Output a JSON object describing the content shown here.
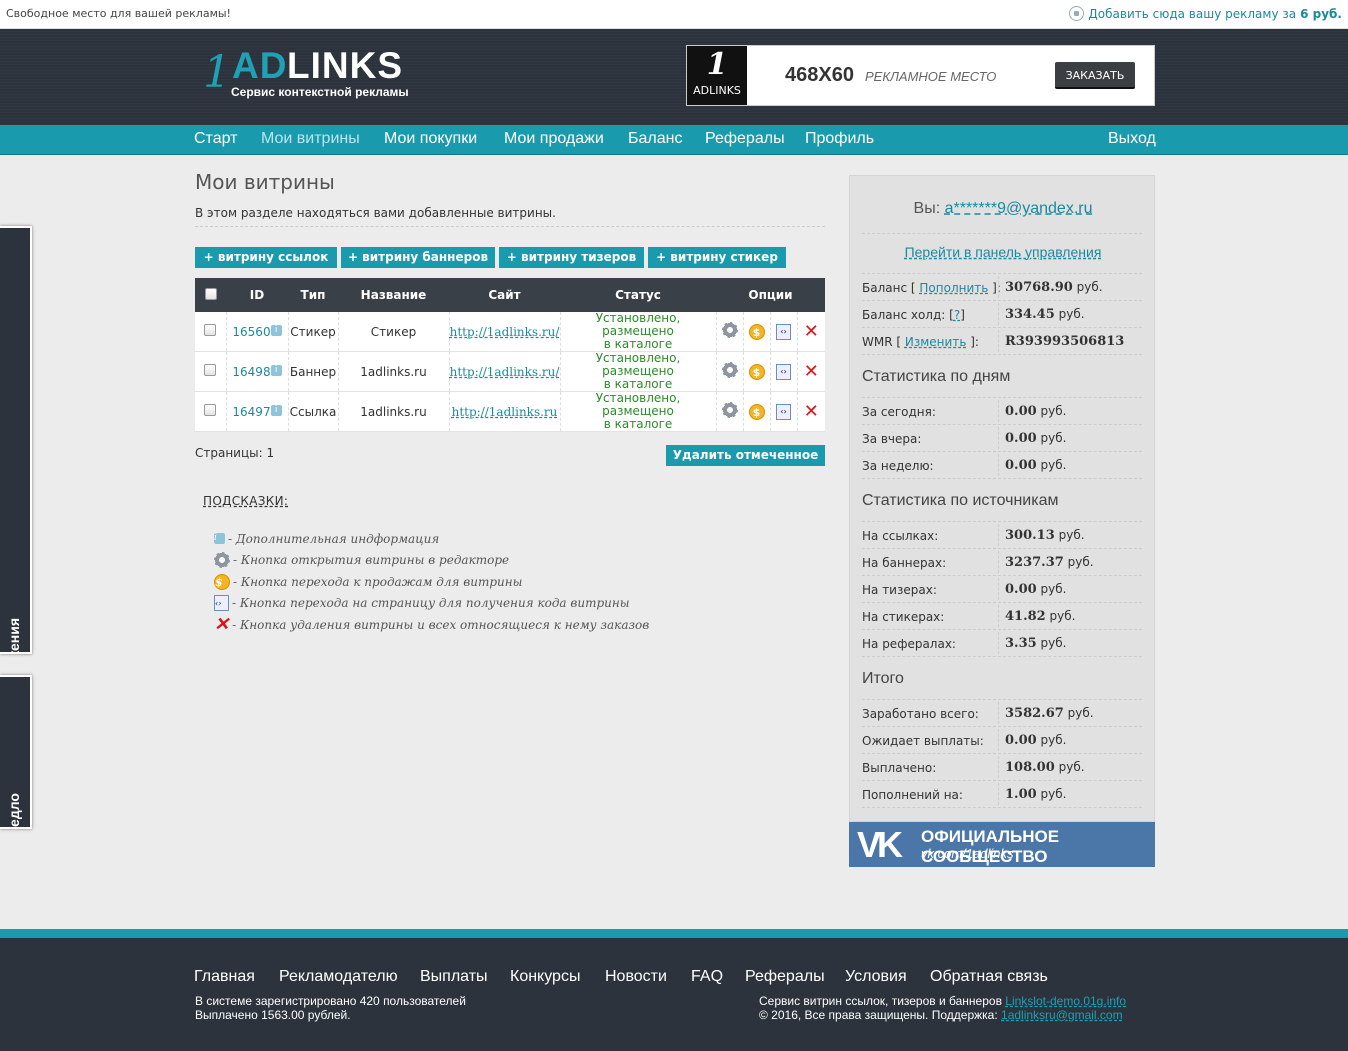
{
  "topbar": {
    "left_text": "Свободное место для вашей рекламы!",
    "right_text": "Добавить сюда вашу рекламу за",
    "right_price": "6 руб."
  },
  "header": {
    "logo_one": "1",
    "logo_ad": "AD",
    "logo_links": "LINKS",
    "logo_sub": "Сервис контекстной рекламы",
    "banner": {
      "mini_num": "1",
      "mini_text": "ADLINKS",
      "size": "468X60",
      "place": "РЕКЛАМНОЕ МЕСТО",
      "order": "ЗАКАЗАТЬ"
    }
  },
  "nav": {
    "items": [
      "Старт",
      "Мои витрины",
      "Мои покупки",
      "Мои продажи",
      "Баланс",
      "Рефералы",
      "Профиль"
    ],
    "logout": "Выход"
  },
  "sidetabs": {
    "tab1": "Отзывы и предлавы и предложения",
    "tab2": "Отзывы и предло"
  },
  "main": {
    "title": "Мои витрины",
    "description": "В этом разделе находяться вами добавленные витрины.",
    "add_buttons": [
      "+ витрину ссылок",
      "+ витрину баннеров",
      "+ витрину тизеров",
      "+ витрину стикер"
    ],
    "table": {
      "headers": [
        "ID",
        "Тип",
        "Название",
        "Сайт",
        "Статус",
        "Опции"
      ],
      "rows": [
        {
          "id": "16560",
          "type": "Стикер",
          "name": "Стикер",
          "site": "http://1adlinks.ru/",
          "status_1": "Установлено, размещено",
          "status_2": "в каталоге"
        },
        {
          "id": "16498",
          "type": "Баннер",
          "name": "1adlinks.ru",
          "site": "http://1adlinks.ru/",
          "status_1": "Установлено, размещено",
          "status_2": "в каталоге"
        },
        {
          "id": "16497",
          "type": "Ссылка",
          "name": "1adlinks.ru",
          "site": "http://1adlinks.ru",
          "status_1": "Установлено, размещено",
          "status_2": "в каталоге"
        }
      ]
    },
    "pages": "Страницы: 1",
    "delete_button": "Удалить отмеченное",
    "hints_title": "ПОДСКАЗКИ:",
    "hints": [
      {
        "icon": "info-icon",
        "text": "- Дополнительная индформация"
      },
      {
        "icon": "gear-icon",
        "text": "- Кнопка открытия витрины в редакторе"
      },
      {
        "icon": "coin-icon",
        "text": "- Кнопка перехода к продажам для витрины"
      },
      {
        "icon": "code-icon",
        "text": "- Кнопка перехода на страницу для получения кода витрины"
      },
      {
        "icon": "delete-icon",
        "text": "- Кнопка удаления витрины и всех относящиеся к нему заказов"
      }
    ]
  },
  "panel": {
    "you_label": "Вы:",
    "email": "a*******9@yandex.ru",
    "control_panel_link": "Перейти в панель управления",
    "balance": [
      {
        "key_pre": "Баланс [",
        "key_link": "Пополнить",
        "key_post": "]:",
        "value": "30768.90",
        "unit": "руб."
      },
      {
        "key_pre": "Баланс холд: [",
        "key_link": "?",
        "key_post": "]",
        "value": "334.45",
        "unit": "руб."
      },
      {
        "key_pre": "WMR [",
        "key_link": "Изменить",
        "key_post": "]:",
        "value": "R393993506813",
        "unit": ""
      }
    ],
    "by_days_title": "Статистика по дням",
    "by_days": [
      {
        "key": "За сегодня:",
        "value": "0.00",
        "unit": "руб."
      },
      {
        "key": "За вчера:",
        "value": "0.00",
        "unit": "руб."
      },
      {
        "key": "За неделю:",
        "value": "0.00",
        "unit": "руб."
      }
    ],
    "by_sources_title": "Статистика по источникам",
    "by_sources": [
      {
        "key": "На ссылках:",
        "value": "300.13",
        "unit": "руб."
      },
      {
        "key": "На баннерах:",
        "value": "3237.37",
        "unit": "руб."
      },
      {
        "key": "На тизерах:",
        "value": "0.00",
        "unit": "руб."
      },
      {
        "key": "На стикерах:",
        "value": "41.82",
        "unit": "руб."
      },
      {
        "key": "На рефералах:",
        "value": "3.35",
        "unit": "руб."
      }
    ],
    "total_title": "Итого",
    "total": [
      {
        "key": "Заработано всего:",
        "value": "3582.67",
        "unit": "руб."
      },
      {
        "key": "Ожидает выплаты:",
        "value": "0.00",
        "unit": "руб."
      },
      {
        "key": "Выплачено:",
        "value": "108.00",
        "unit": "руб."
      },
      {
        "key": "Пополнений на:",
        "value": "1.00",
        "unit": "руб."
      }
    ]
  },
  "vk": {
    "logo": "VK",
    "title": "ОФИЦИАЛЬНОЕ СООБЩЕСТВО",
    "url": "vk.com/1adlinks"
  },
  "footer": {
    "nav": [
      "Главная",
      "Рекламодателю",
      "Выплаты",
      "Конкурсы",
      "Новости",
      "FAQ",
      "Рефералы",
      "Условия",
      "Обратная связь"
    ],
    "left_line1": "В системе зарегистрировано 420 пользователей",
    "left_line2": "Выплачено 1563.00 рублей.",
    "right_line1": "Сервис витрин ссылок, тизеров и баннеров",
    "right_link1": "Linkslot-demo.01g.info",
    "right_line2": "© 2016, Все права защищены. Поддержка:",
    "right_link2": "1adlinksru@gmail.com"
  },
  "colors": {
    "accent": "#1a9bad",
    "header_bg": "#2c333c",
    "status_green": "#2d8a2d",
    "delete_red": "#d6161b",
    "vk_blue": "#4a76a8"
  }
}
